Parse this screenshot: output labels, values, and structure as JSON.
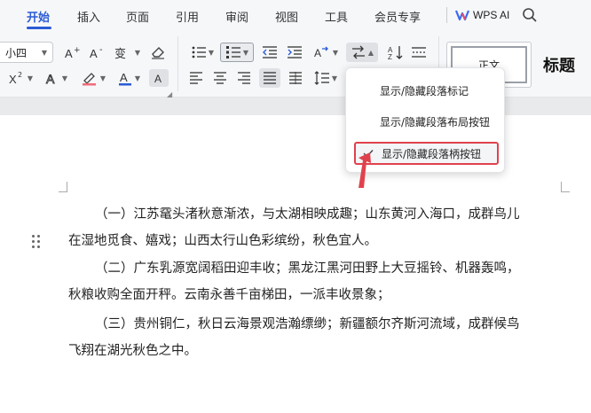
{
  "menu": {
    "tabs": [
      "开始",
      "插入",
      "页面",
      "引用",
      "审阅",
      "视图",
      "工具",
      "会员专享"
    ],
    "active_tab": "开始",
    "wps_ai_label": "WPS AI"
  },
  "ribbon": {
    "font_size": "小四",
    "style_normal": "正文",
    "style_title": "标题"
  },
  "dropdown": {
    "items": [
      {
        "label": "显示/隐藏段落标记",
        "checked": false
      },
      {
        "label": "显示/隐藏段落布局按钮",
        "checked": false
      },
      {
        "label": "显示/隐藏段落柄按钮",
        "checked": true
      }
    ]
  },
  "document": {
    "paragraphs": [
      [
        "（一）江苏鼋头渚秋意渐浓，与太湖相映成趣；山东黄河入海口，成群鸟儿",
        "在湿地觅食、嬉戏；山西太行山色彩缤纷，秋色宜人。"
      ],
      [
        "（二）广东乳源宽阔稻田迎丰收；黑龙江黑河田野上大豆摇铃、机器轰鸣，",
        "秋粮收购全面开秤。云南永善千亩梯田，一派丰收景象；"
      ],
      [
        "（三）贵州铜仁，秋日云海景观浩瀚缥缈；新疆额尔齐斯河流域，成群候鸟",
        "飞翔在湖光秋色之中。"
      ]
    ]
  },
  "colors": {
    "accent": "#2b5bd6",
    "highlight_border": "#e0424d",
    "pointer_arrow": "#e0424d"
  }
}
